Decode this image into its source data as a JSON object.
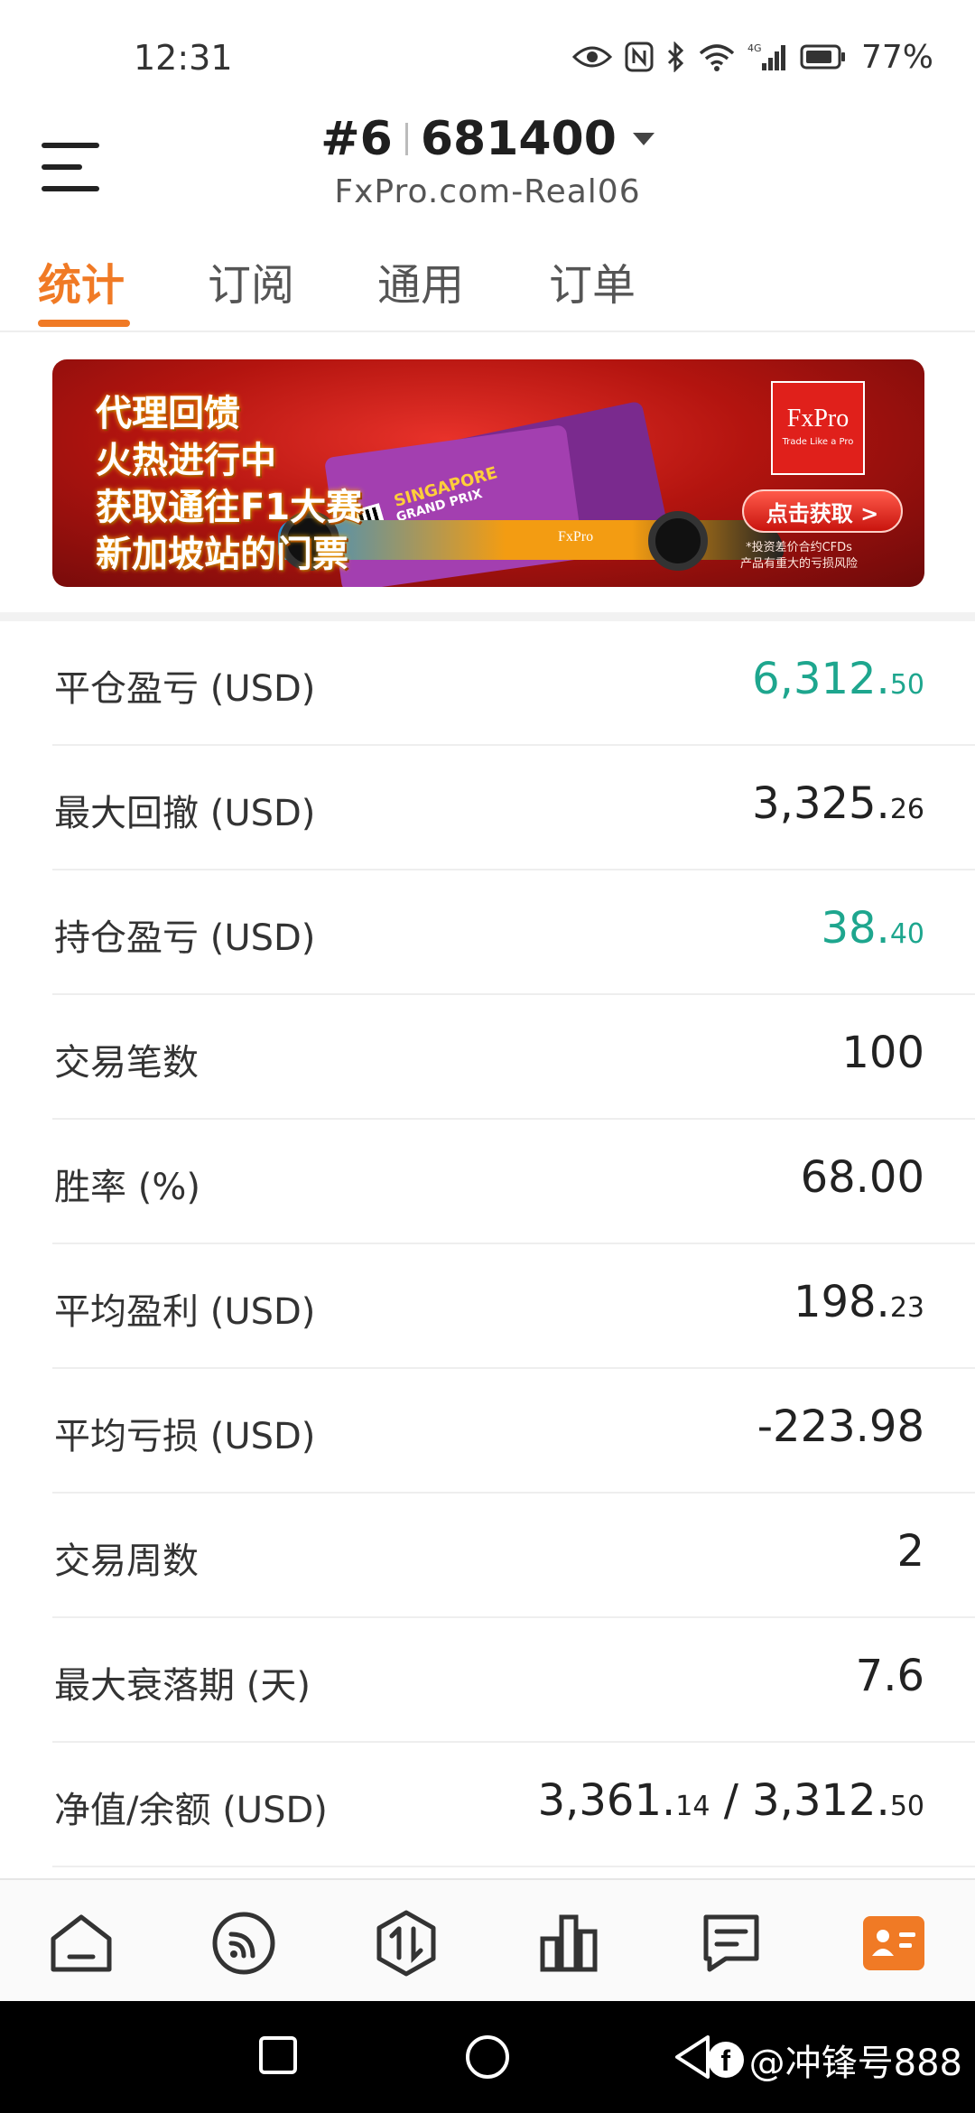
{
  "status_bar": {
    "time": "12:31",
    "battery": "77%",
    "network": "4G"
  },
  "header": {
    "account_prefix": "#6",
    "account_number": "681400",
    "server": "FxPro.com-Real06"
  },
  "tabs": [
    {
      "label": "统计",
      "active": true
    },
    {
      "label": "订阅",
      "active": false
    },
    {
      "label": "通用",
      "active": false
    },
    {
      "label": "订单",
      "active": false
    }
  ],
  "banner": {
    "lines": [
      "代理回馈",
      "火热进行中",
      "获取通往F1大赛",
      "新加坡站的门票"
    ],
    "ticket_title": "SINGAPORE",
    "ticket_subtitle": "GRAND PRIX",
    "brand": "FxPro",
    "brand_tagline": "Trade Like a Pro",
    "car_brand": "FxPro",
    "cta": "点击获取 >",
    "risk_line1": "*投资差价合约CFDs",
    "risk_line2": "产品有重大的亏损风险"
  },
  "stats": [
    {
      "label": "平仓盈亏 (USD)",
      "int": "6,312.",
      "dec": "50",
      "color": "green"
    },
    {
      "label": "最大回撤 (USD)",
      "int": "3,325.",
      "dec": "26",
      "color": "default"
    },
    {
      "label": "持仓盈亏 (USD)",
      "int": "38.",
      "dec": "40",
      "color": "green"
    },
    {
      "label": "交易笔数",
      "int": "100",
      "dec": "",
      "color": "default"
    },
    {
      "label": "胜率 (%)",
      "int": "68.00",
      "dec": "",
      "color": "default"
    },
    {
      "label": "平均盈利 (USD)",
      "int": "198.",
      "dec": "23",
      "color": "default"
    },
    {
      "label": "平均亏损 (USD)",
      "int": "-223.98",
      "dec": "",
      "color": "default"
    },
    {
      "label": "交易周数",
      "int": "2",
      "dec": "",
      "color": "default"
    },
    {
      "label": "最大衰落期 (天)",
      "int": "7.6",
      "dec": "",
      "color": "default"
    }
  ],
  "equity_row": {
    "label": "净值/余额 (USD)",
    "equity_int": "3,361.",
    "equity_dec": "14",
    "separator": " / ",
    "balance_int": "3,312.",
    "balance_dec": "50"
  },
  "bottom_nav": [
    {
      "name": "home-icon",
      "active": false
    },
    {
      "name": "signal-icon",
      "active": false
    },
    {
      "name": "trade-icon",
      "active": false
    },
    {
      "name": "chart-icon",
      "active": false
    },
    {
      "name": "messages-icon",
      "active": false
    },
    {
      "name": "profile-icon",
      "active": true
    }
  ],
  "watermark": "@冲锋号888",
  "colors": {
    "accent": "#f07a25",
    "positive": "#1ea68e",
    "banner_red": "#b3140f"
  }
}
